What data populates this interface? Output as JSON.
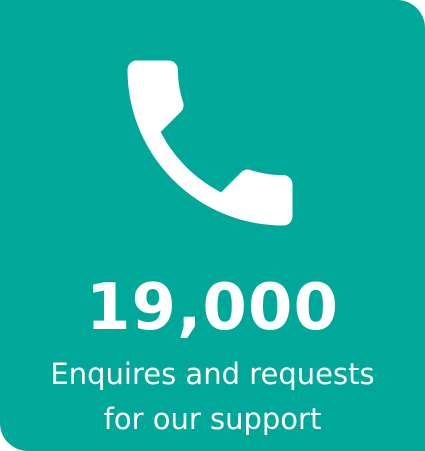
{
  "colors": {
    "background": "#00a89a",
    "foreground": "#ffffff"
  },
  "icon": "phone-icon",
  "stat": {
    "number": "19,000",
    "label_line1": "Enquires and requests",
    "label_line2": "for our support"
  }
}
